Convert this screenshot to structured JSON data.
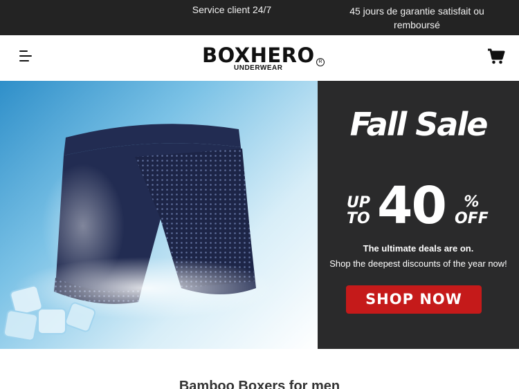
{
  "announcement": {
    "left": "Service client 24/7",
    "right": "45 jours de garantie satisfait ou remboursé"
  },
  "header": {
    "brand": "BOXHERO",
    "brand_sub": "UNDERWEAR",
    "registered": "R",
    "menu_icon": "hamburger-menu-icon",
    "cart_icon": "shopping-cart-icon"
  },
  "hero": {
    "title": "Fall Sale",
    "up_to": [
      "UP",
      "TO"
    ],
    "discount": "40",
    "percent": "%",
    "off": "OFF",
    "line1": "The ultimate deals are on.",
    "line2": "Shop the deepest discounts of the year now!",
    "button": "SHOP NOW",
    "button_color": "#c51a1a",
    "panel_color": "#2a2a2b"
  },
  "section": {
    "title": "Bamboo Boxers for men"
  }
}
